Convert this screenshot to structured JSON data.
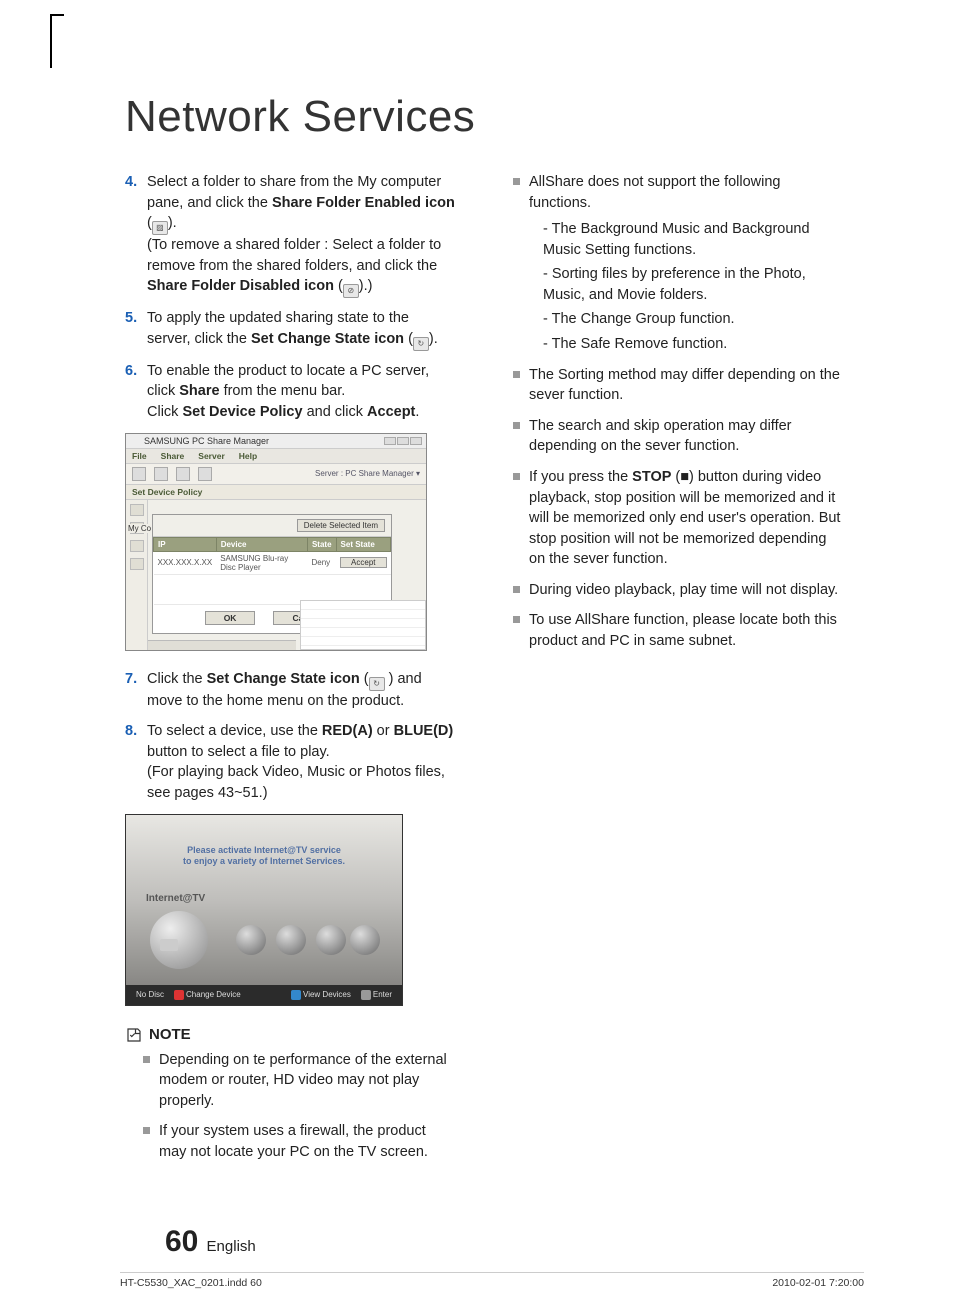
{
  "title": "Network Services",
  "steps": {
    "s4": {
      "num": "4.",
      "l1": "Select a folder to share from the My computer pane, and click the ",
      "b1": "Share Folder Enabled icon",
      "l2": " (",
      "icon1_name": "share-enabled-icon",
      "l3": ").",
      "l4": "(To remove a shared folder : Select a folder to remove from the shared folders, and click the ",
      "b2": "Share Folder Disabled icon",
      "l5": " (",
      "icon2_name": "share-disabled-icon",
      "l6": ").)"
    },
    "s5": {
      "num": "5.",
      "l1": "To apply the updated sharing state to the server, click the ",
      "b1": "Set Change State icon",
      "l2": " (",
      "icon_name": "set-change-state-icon",
      "l3": ")."
    },
    "s6": {
      "num": "6.",
      "l1": "To enable the product to locate a PC server, click ",
      "b1": "Share",
      "l2": " from the menu bar.",
      "l3": "Click ",
      "b2": "Set Device Policy",
      "l4": " and click ",
      "b3": "Accept",
      "l5": "."
    },
    "s7": {
      "num": "7.",
      "l1": "Click the ",
      "b1": "Set Change State icon",
      "l2": " (",
      "icon_name": "set-change-state-icon",
      "l3": " ) and move to the home menu on the product."
    },
    "s8": {
      "num": "8.",
      "l1": "To select a device, use the ",
      "b1": "RED(A)",
      "l2": " or ",
      "b2": "BLUE(D)",
      "l3": " button to select a file to play.",
      "l4": "(For playing back Video, Music or Photos files, see pages 43~51.)"
    }
  },
  "dialog": {
    "title": "SAMSUNG PC Share Manager",
    "menu": [
      "File",
      "Share",
      "Server",
      "Help"
    ],
    "server_label": "Server : PC Share Manager",
    "set_device_policy": "Set Device Policy",
    "my_co": "My Co",
    "delete_btn": "Delete Selected Item",
    "headers": [
      "IP",
      "Device",
      "State",
      "Set State"
    ],
    "row": {
      "ip": "XXX.XXX.X.XX",
      "device": "SAMSUNG Blu-ray Disc Player",
      "state": "Deny",
      "accept": "Accept"
    },
    "ok": "OK",
    "cancel": "Cancel"
  },
  "tv": {
    "banner_l1": "Please activate Internet@TV service",
    "banner_l2": "to enjoy a variety of Internet Services.",
    "itv": "Internet@TV",
    "bar_no_disc": "No Disc",
    "bar_change": "Change Device",
    "bar_view": "View Devices",
    "bar_enter": "Enter"
  },
  "note_label": "NOTE",
  "notes_left": [
    "Depending on te performance of the external modem or router, HD video may not play properly.",
    "If your system uses a firewall, the product may not locate your PC on the TV screen."
  ],
  "notes_right": {
    "n1": {
      "text": "AllShare does not support the following functions.",
      "sub": [
        "The Background Music and Background Music Setting functions.",
        "Sorting files by preference in the Photo, Music, and Movie folders.",
        "The Change Group function.",
        "The Safe Remove function."
      ]
    },
    "n2": "The Sorting method may differ depending on the sever function.",
    "n3": "The search and skip operation may differ depending on the sever function.",
    "n4": {
      "pre": "If you press the ",
      "b": "STOP",
      "post": " (■) button during video playback, stop position will be memorized and it will be memorized only end user's operation. But stop position will not be memorized depending on the sever function."
    },
    "n5": "During video playback, play time will not display.",
    "n6": "To use AllShare function, please locate both this product and PC in same subnet."
  },
  "footer": {
    "num": "60",
    "lang": "English"
  },
  "indd": {
    "file": "HT-C5530_XAC_0201.indd   60",
    "date": "2010-02-01    7:20:00"
  }
}
